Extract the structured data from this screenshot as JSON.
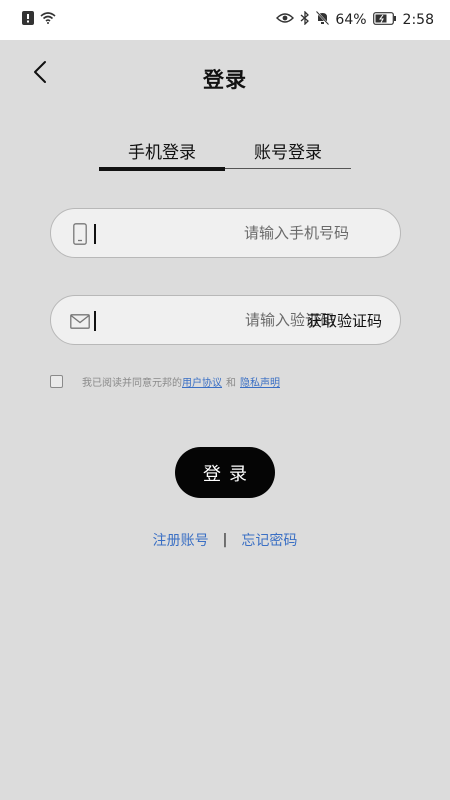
{
  "status_bar": {
    "battery_percent": "64%",
    "time": "2:58"
  },
  "header": {
    "title": "登录"
  },
  "tabs": [
    {
      "label": "手机登录",
      "active": true
    },
    {
      "label": "账号登录",
      "active": false
    }
  ],
  "phone_field": {
    "placeholder": "请输入手机号码",
    "value": ""
  },
  "code_field": {
    "placeholder": "请输入验证码",
    "value": "",
    "get_code_label": "获取验证码"
  },
  "agreement": {
    "checked": false,
    "text": "我已阅读并同意元邦的",
    "user_agreement": "用户协议",
    "and": "和",
    "privacy": "隐私声明"
  },
  "login_button": {
    "label": "登录"
  },
  "links": {
    "register": "注册账号",
    "separator": "|",
    "forgot": "忘记密码"
  },
  "colors": {
    "background": "#dcdcdc",
    "accent_link": "#3a6fc4",
    "button": "#050505"
  }
}
